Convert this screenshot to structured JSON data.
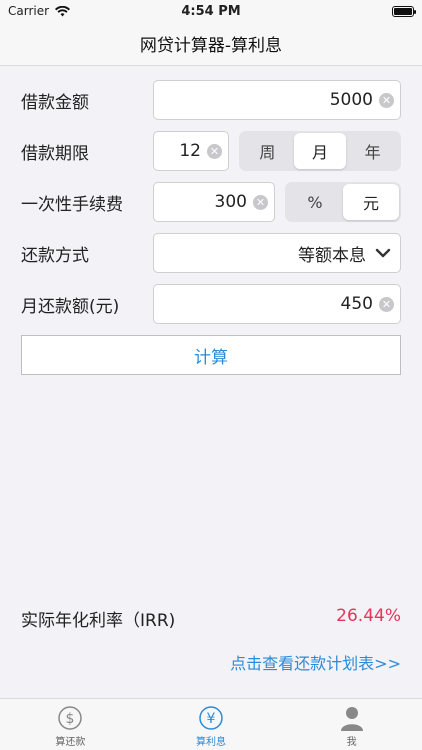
{
  "status": {
    "carrier": "Carrier",
    "time": "4:54 PM"
  },
  "nav": {
    "title": "网贷计算器-算利息"
  },
  "form": {
    "loan_amount": {
      "label": "借款金额",
      "value": "5000"
    },
    "loan_term": {
      "label": "借款期限",
      "value": "12",
      "units": [
        "周",
        "月",
        "年"
      ],
      "selected": "月"
    },
    "fee": {
      "label": "一次性手续费",
      "value": "300",
      "units": [
        "%",
        "元"
      ],
      "selected": "元"
    },
    "repay_method": {
      "label": "还款方式",
      "value": "等额本息"
    },
    "monthly_payment": {
      "label": "月还款额(元)",
      "value": "450"
    }
  },
  "calc_button": "计算",
  "result": {
    "label": "实际年化利率（IRR)",
    "value": "26.44%"
  },
  "plan_link": "点击查看还款计划表>>",
  "tabs": [
    {
      "label": "算还款",
      "icon": "dollar-circle-icon",
      "active": false
    },
    {
      "label": "算利息",
      "icon": "yen-circle-icon",
      "active": true
    },
    {
      "label": "我",
      "icon": "person-icon",
      "active": false
    }
  ],
  "colors": {
    "accent": "#2a8bd8",
    "result": "#e8335a"
  }
}
